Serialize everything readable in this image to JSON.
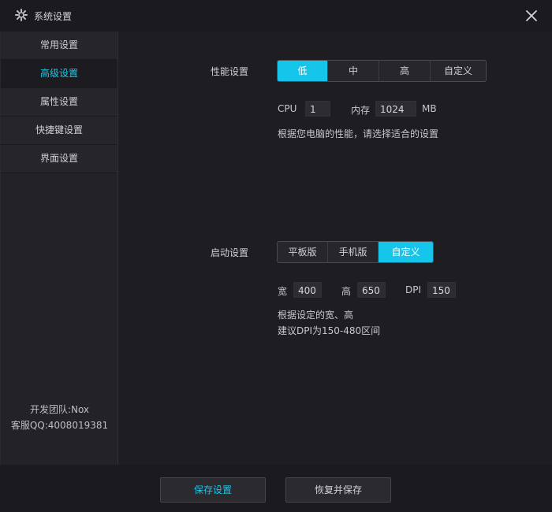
{
  "window": {
    "title": "系统设置",
    "gear_icon": "gear-icon",
    "close_icon": "close-icon"
  },
  "sidebar": {
    "items": [
      {
        "label": "常用设置",
        "active": false
      },
      {
        "label": "高级设置",
        "active": true
      },
      {
        "label": "属性设置",
        "active": false
      },
      {
        "label": "快捷键设置",
        "active": false
      },
      {
        "label": "界面设置",
        "active": false
      }
    ],
    "footer": {
      "team": "开发团队:Nox",
      "support": "客服QQ:4008019381"
    }
  },
  "performance": {
    "label": "性能设置",
    "options": [
      "低",
      "中",
      "高",
      "自定义"
    ],
    "selected": "低",
    "cpu_label": "CPU",
    "cpu_value": "1",
    "mem_label": "内存",
    "mem_value": "1024",
    "mem_unit": "MB",
    "hint": "根据您电脑的性能，请选择适合的设置"
  },
  "startup": {
    "label": "启动设置",
    "options": [
      "平板版",
      "手机版",
      "自定义"
    ],
    "selected": "自定义",
    "width_label": "宽",
    "width_value": "400",
    "height_label": "高",
    "height_value": "650",
    "dpi_label": "DPI",
    "dpi_value": "150",
    "hint_line1": "根据设定的宽、高",
    "hint_line2": "建议DPI为150-480区间"
  },
  "actions": {
    "save": "保存设置",
    "restore": "恢复并保存"
  },
  "colors": {
    "accent": "#16c6ea",
    "background": "#1e1e22",
    "sidebar": "#25252a"
  }
}
